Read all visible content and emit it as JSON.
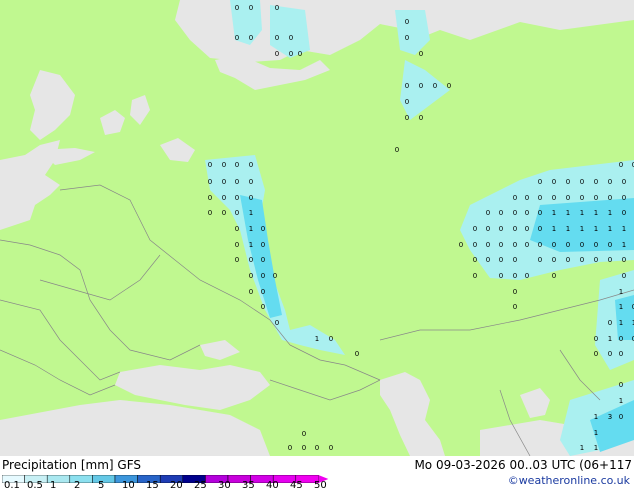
{
  "legend": {
    "title": "Precipitation [mm]",
    "model": "GFS",
    "ticks": [
      "0.1",
      "0.5",
      "1",
      "2",
      "5",
      "10",
      "15",
      "20",
      "25",
      "30",
      "35",
      "40",
      "45",
      "50"
    ],
    "colors": [
      "#e6faff",
      "#c8f0f5",
      "#aae8f0",
      "#8ce0ef",
      "#64c8e6",
      "#3c96dc",
      "#2864c8",
      "#1e3cb4",
      "#00008c",
      "#b400dc",
      "#c800dc",
      "#d200e6",
      "#e600f0",
      "#f000f0"
    ]
  },
  "timestamp": "Mo 09-03-2026 00..03 UTC (06+117",
  "credit": "©weatheronline.co.uk",
  "colors": {
    "land": "#c0f890",
    "sea": "#e6e6e6",
    "precip_light": "#aaf0f0",
    "precip_medium": "#64dcf0",
    "border": "#888888"
  }
}
